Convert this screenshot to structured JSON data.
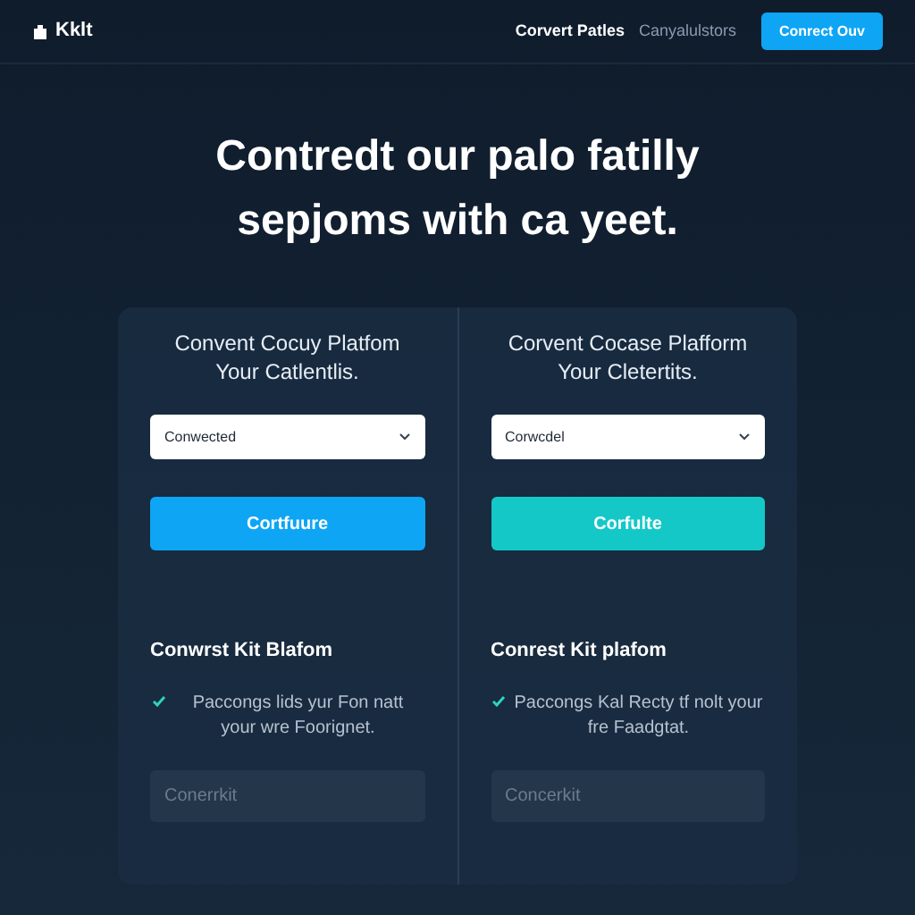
{
  "header": {
    "logo": "Kklt",
    "nav": [
      {
        "label": "Corvert Patles",
        "selected": true
      },
      {
        "label": "Canyalulstors",
        "selected": false
      }
    ],
    "cta": "Conrect Ouv"
  },
  "hero": {
    "title": "Contredt our palo fatilly sepjoms with ca yeet."
  },
  "panels": [
    {
      "title": "Convent Cocuy Platfom Your Catlentlis.",
      "select": "Conwected",
      "button": "Cortfuure",
      "color": "#0ea5f5",
      "subtitle": "Conwrst Kit Blafom",
      "feature": {
        "text": "Paccongs lids yur Fon natt your wre Foorignet.",
        "checked": true
      },
      "input_placeholder": "Conerrkit"
    },
    {
      "title": "Corvent Cocase Plafform Your Cletertits.",
      "select": "Corwcdel",
      "button": "Corfulte",
      "color": "#14c8c8",
      "subtitle": "Conrest Kit plafom",
      "feature": {
        "text": "Paccongs Kal Recty tf nolt your fre Faadgtat.",
        "checked": true
      },
      "input_placeholder": "Concerkit"
    }
  ]
}
